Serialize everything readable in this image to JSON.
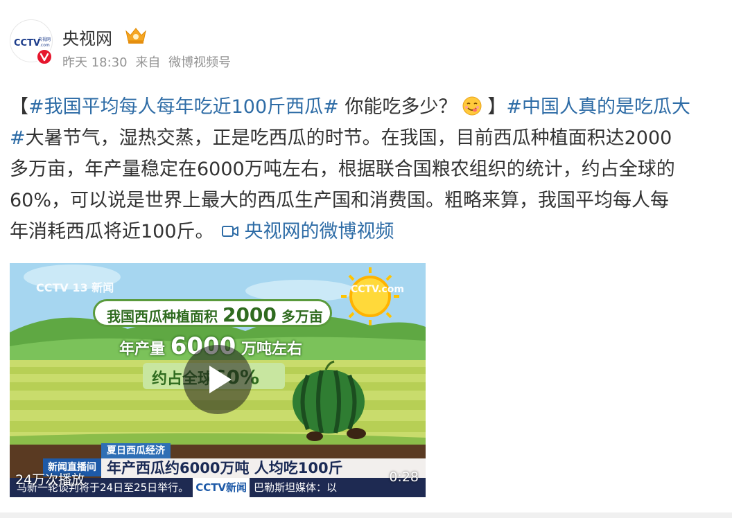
{
  "post": {
    "author": "央视网",
    "time": "昨天 18:30",
    "source_prefix": "来自",
    "source": "微博视频号",
    "text": {
      "l1_bracket_open": "【",
      "l1_tag": "#我国平均每人每年吃近100斤西瓜#",
      "l1_plain": " 你能吃多少？",
      "l1_bracket_close": "】",
      "l1_tag2": "#中国人真的是吃瓜大",
      "l2_tag": "#",
      "l2_plain": "大暑节气，湿热交蒸，正是吃西瓜的时节。在我国，目前西瓜种植面积达2000",
      "l3": "多万亩，年产量稳定在6000万吨左右，根据联合国粮农组织的统计，约占全球的",
      "l4": "60%，可以说是世界上最大的西瓜生产国和消费国。粗略来算，我国平均每人每",
      "l5_plain": "年消耗西瓜将近100斤。",
      "video_link": "央视网的微博视频"
    },
    "video": {
      "line1_a": "我国西瓜种植面积",
      "line1_num": "2000",
      "line1_b": "多万亩",
      "line2_a": "年产量",
      "line2_num": "6000",
      "line2_b": "万吨左右",
      "line3_a": "约占全球",
      "line3_num": "60%",
      "watermark_left": "CCTV 13 新闻",
      "watermark_right": "CCTV.com",
      "news_category": "夏日西瓜经济",
      "news_logo": "新闻直播间",
      "headline": "年产西瓜约6000万吨 人均吃100斤",
      "ticker_a": "马新一轮谈判将于24日至25日举行。",
      "ticker_logo": "CCTV新闻",
      "ticker_b": "巴勒斯坦媒体：以",
      "play_count": "24万次播放",
      "duration": "0:28"
    }
  },
  "colors": {
    "link": "#2e6ca6",
    "meta": "#939393",
    "verified": "#e6162d"
  }
}
